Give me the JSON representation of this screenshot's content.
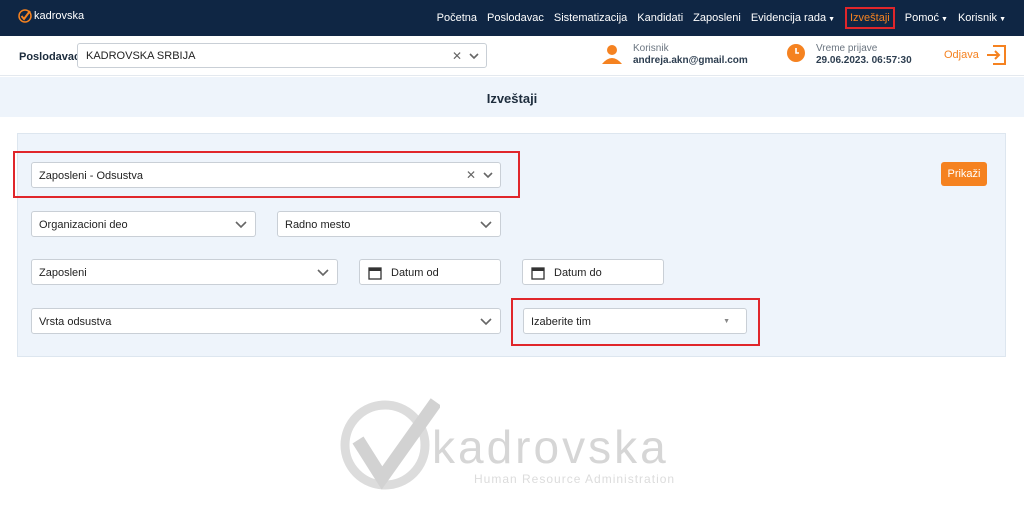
{
  "app": {
    "logo_text": "kadrovska"
  },
  "nav": {
    "items": [
      "Početna",
      "Poslodavac",
      "Sistematizacija",
      "Kandidati",
      "Zaposleni",
      "Evidencija rada",
      "Izveštaji",
      "Pomoć",
      "Korisnik"
    ]
  },
  "employer": {
    "label": "Poslodavac",
    "value": "KADROVSKA SRBIJA"
  },
  "user": {
    "label": "Korisnik",
    "email": "andreja.akn@gmail.com"
  },
  "login": {
    "label": "Vreme prijave",
    "time": "29.06.2023. 06:57:30"
  },
  "logout": {
    "label": "Odjava"
  },
  "page": {
    "title": "Izveštaji"
  },
  "form": {
    "report_type": "Zaposleni - Odsustva",
    "submit_label": "Prikaži",
    "org_unit": "Organizacioni deo",
    "position": "Radno mesto",
    "employee": "Zaposleni",
    "date_from": "Datum od",
    "date_to": "Datum do",
    "absence_type": "Vrsta odsustva",
    "team": "Izaberite tim"
  },
  "watermark": {
    "brand": "kadrovska",
    "tagline": "Human Resource Administration"
  },
  "colors": {
    "navbar": "#0f2644",
    "accent": "#f58220",
    "highlight": "#e0262b",
    "panel": "#eef4fb"
  }
}
